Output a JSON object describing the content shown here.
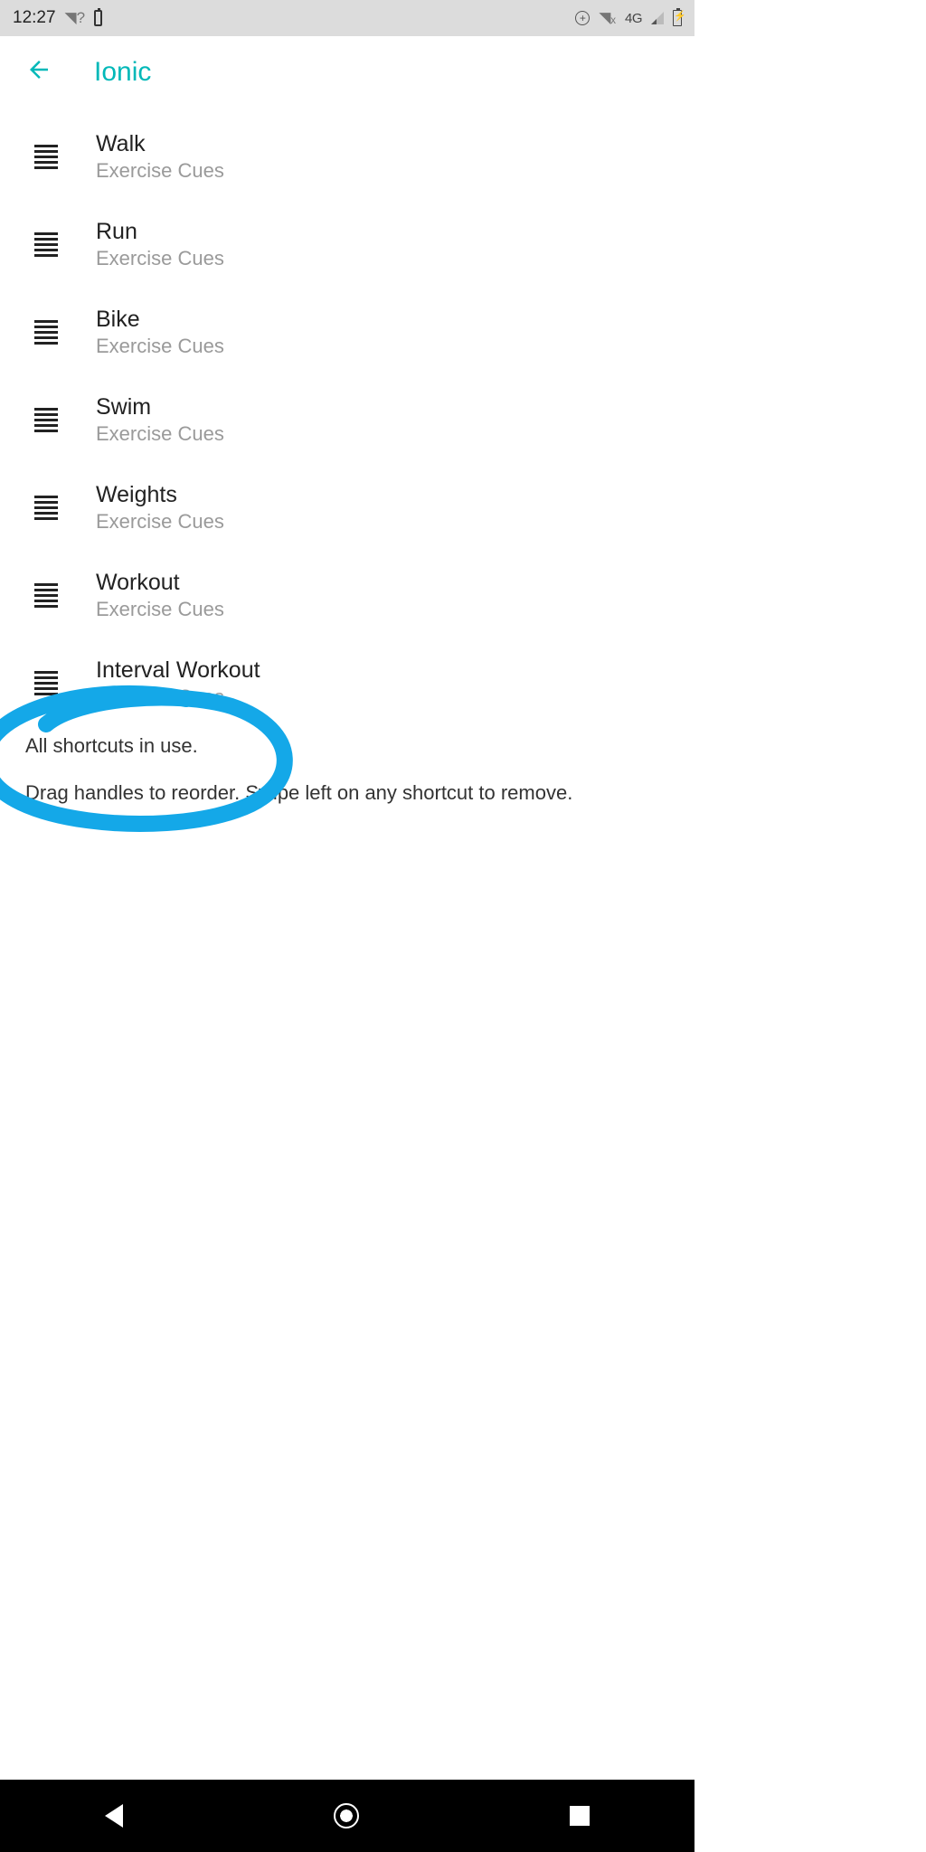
{
  "status": {
    "time": "12:27",
    "network_label": "4G"
  },
  "header": {
    "title": "Ionic"
  },
  "exercises": [
    {
      "name": "Walk",
      "sub": "Exercise Cues"
    },
    {
      "name": "Run",
      "sub": "Exercise Cues"
    },
    {
      "name": "Bike",
      "sub": "Exercise Cues"
    },
    {
      "name": "Swim",
      "sub": "Exercise Cues"
    },
    {
      "name": "Weights",
      "sub": "Exercise Cues"
    },
    {
      "name": "Workout",
      "sub": "Exercise Cues"
    },
    {
      "name": "Interval Workout",
      "sub": "Exercise Cues"
    }
  ],
  "footer": {
    "shortcuts_msg": "All shortcuts in use.",
    "hint": "Drag handles to reorder. Swipe left on any shortcut to remove."
  }
}
